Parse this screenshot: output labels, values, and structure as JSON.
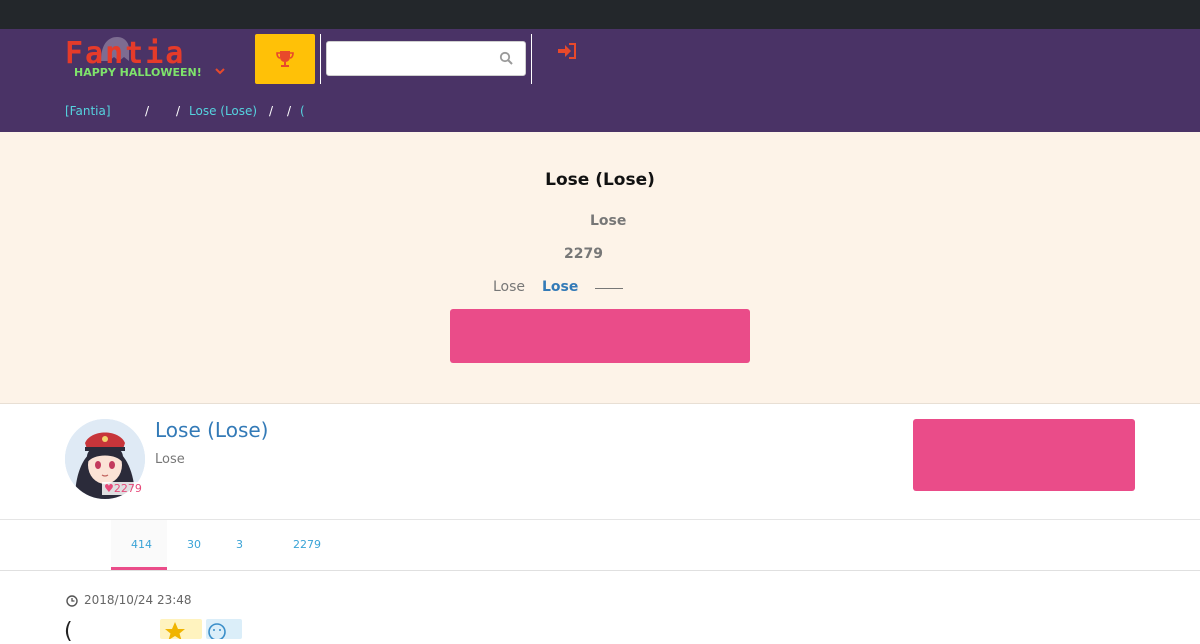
{
  "header": {
    "logo_text": "Fantia",
    "logo_tagline": "HAPPY HALLOWEEN!",
    "search_placeholder": "",
    "colors": {
      "header_bg": "#4a3366",
      "topbar_bg": "#23272b",
      "accent_yellow": "#ffc107",
      "logo_red": "#e53b2a"
    },
    "icons": [
      "ghost-icon",
      "chevron-down-icon",
      "trophy-icon",
      "search-icon",
      "sign-in-icon"
    ]
  },
  "breadcrumb": {
    "items": [
      "[Fantia]",
      "Lose (Lose)",
      "("
    ],
    "separator": "/"
  },
  "hero": {
    "title": "Lose (Lose)",
    "subtitle": "Lose",
    "count": "2279",
    "link_plain": "Lose",
    "link_active": "Lose",
    "button_label": "",
    "colors": {
      "bg": "#fdf3e8",
      "button": "#ea4c89"
    }
  },
  "profile": {
    "name": "Lose (Lose)",
    "subtitle": "Lose",
    "likes": "2279",
    "button_label": ""
  },
  "tabs": [
    {
      "label": "414",
      "active": true
    },
    {
      "label": "30",
      "active": false
    },
    {
      "label": "3",
      "active": false
    },
    {
      "label": "2279",
      "active": false
    }
  ],
  "post": {
    "date": "2018/10/24 23:48",
    "leading_glyph": "(",
    "badges": [
      "star-icon",
      "smile-icon"
    ]
  }
}
